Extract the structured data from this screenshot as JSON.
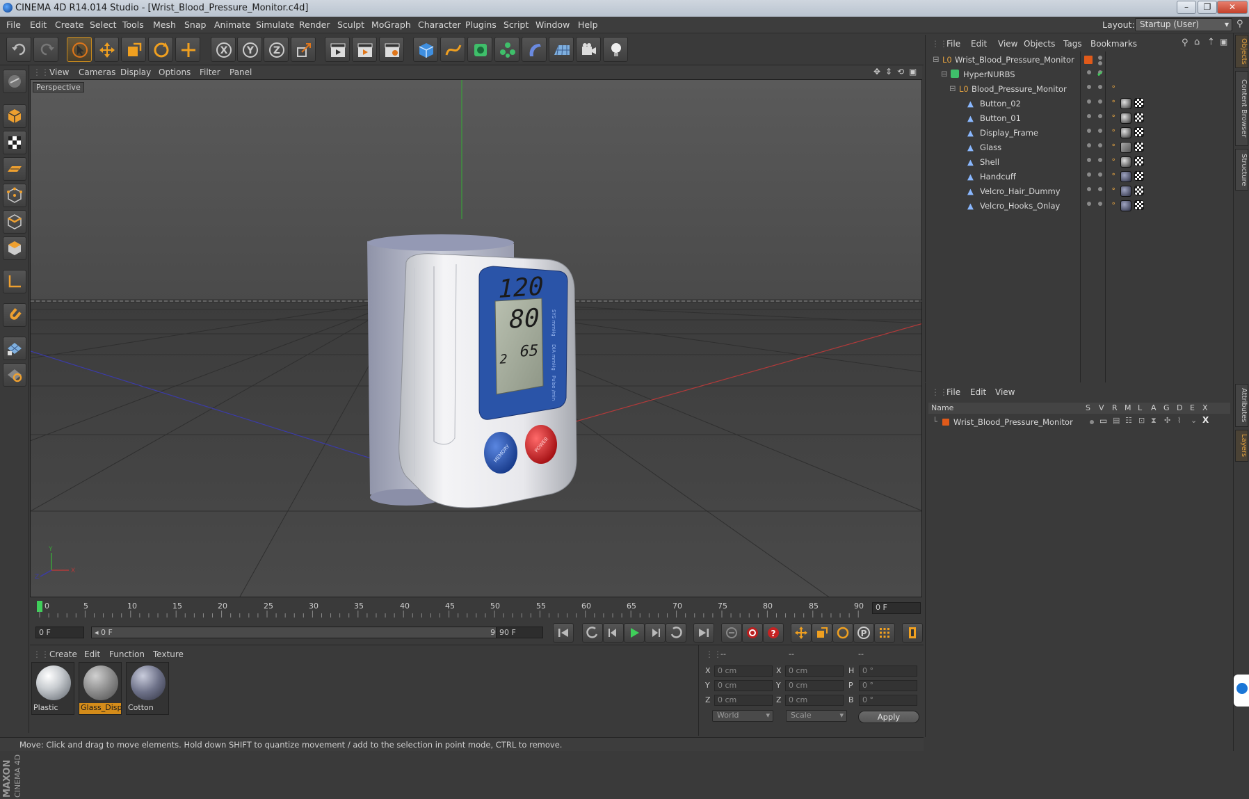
{
  "window": {
    "title": "CINEMA 4D R14.014 Studio - [Wrist_Blood_Pressure_Monitor.c4d]",
    "min": "–",
    "max": "❐",
    "close": "✕"
  },
  "menubar": {
    "items": [
      "File",
      "Edit",
      "Create",
      "Select",
      "Tools",
      "Mesh",
      "Snap",
      "Animate",
      "Simulate",
      "Render",
      "Sculpt",
      "MoGraph",
      "Character",
      "Plugins",
      "Script",
      "Window",
      "Help"
    ],
    "layout_label": "Layout:",
    "layout_value": "Startup (User)"
  },
  "viewport": {
    "menu": [
      "View",
      "Cameras",
      "Display",
      "Options",
      "Filter",
      "Panel"
    ],
    "label": "Perspective",
    "lcd": {
      "sys": "120",
      "dia": "80",
      "pulse": "65",
      "memory_no": "2"
    },
    "button_left": "MEMORY",
    "button_right": "POWER",
    "side_labels": [
      "SYS mmHg",
      "DIA mmHg",
      "Pulse /min"
    ],
    "axis": {
      "y": "Y",
      "z": "Z",
      "x": "X"
    }
  },
  "timeline": {
    "ticks": [
      "0",
      "5",
      "10",
      "15",
      "20",
      "25",
      "30",
      "35",
      "40",
      "45",
      "50",
      "55",
      "60",
      "65",
      "70",
      "75",
      "80",
      "85",
      "90"
    ],
    "current_frame": "0 F",
    "start_field": "0 F",
    "range_start": "◂ 0 F",
    "range_end": "90 F ▸",
    "end_field": "90 F"
  },
  "materials": {
    "menu": [
      "Create",
      "Edit",
      "Function",
      "Texture"
    ],
    "items": [
      {
        "name": "Plastic",
        "selected": false
      },
      {
        "name": "Glass_Disp",
        "selected": true
      },
      {
        "name": "Cotton",
        "selected": false
      }
    ]
  },
  "coords": {
    "headers": [
      "--",
      "--",
      "--"
    ],
    "rows": [
      {
        "l1": "X",
        "v1": "0 cm",
        "l2": "X",
        "v2": "0 cm",
        "l3": "H",
        "v3": "0 °"
      },
      {
        "l1": "Y",
        "v1": "0 cm",
        "l2": "Y",
        "v2": "0 cm",
        "l3": "P",
        "v3": "0 °"
      },
      {
        "l1": "Z",
        "v1": "0 cm",
        "l2": "Z",
        "v2": "0 cm",
        "l3": "B",
        "v3": "0 °"
      }
    ],
    "space": "World",
    "mode": "Scale",
    "apply": "Apply"
  },
  "status": "Move: Click and drag to move elements. Hold down SHIFT to quantize movement / add to the selection in point mode, CTRL to remove.",
  "object_manager": {
    "menu": [
      "File",
      "Edit",
      "View",
      "Objects",
      "Tags",
      "Bookmarks"
    ],
    "objects": [
      {
        "name": "Wrist_Blood_Pressure_Monitor",
        "depth": 0,
        "type": "null"
      },
      {
        "name": "HyperNURBS",
        "depth": 1,
        "type": "hypernurbs"
      },
      {
        "name": "Blood_Pressure_Monitor",
        "depth": 2,
        "type": "null"
      },
      {
        "name": "Button_02",
        "depth": 3,
        "type": "poly"
      },
      {
        "name": "Button_01",
        "depth": 3,
        "type": "poly"
      },
      {
        "name": "Display_Frame",
        "depth": 3,
        "type": "poly"
      },
      {
        "name": "Glass",
        "depth": 3,
        "type": "poly"
      },
      {
        "name": "Shell",
        "depth": 3,
        "type": "poly"
      },
      {
        "name": "Handcuff",
        "depth": 3,
        "type": "poly"
      },
      {
        "name": "Velcro_Hair_Dummy",
        "depth": 3,
        "type": "poly"
      },
      {
        "name": "Velcro_Hooks_Onlay",
        "depth": 3,
        "type": "poly"
      }
    ]
  },
  "layer_manager": {
    "menu": [
      "File",
      "Edit",
      "View"
    ],
    "header_name": "Name",
    "header_cols": [
      "S",
      "V",
      "R",
      "M",
      "L",
      "A",
      "G",
      "D",
      "E",
      "X"
    ],
    "layers": [
      {
        "name": "Wrist_Blood_Pressure_Monitor",
        "color": "#e05a1a"
      }
    ]
  },
  "right_tabs": [
    "Objects",
    "Content Browser",
    "Structure",
    "Attributes",
    "Layers"
  ],
  "brand": {
    "logo_text": "MAXON CINEMA 4D"
  },
  "colors": {
    "accent": "#d48c1a",
    "lcd_blue": "#2a54a8",
    "power_red": "#c8151b",
    "memory_blue": "#1e48a0"
  }
}
